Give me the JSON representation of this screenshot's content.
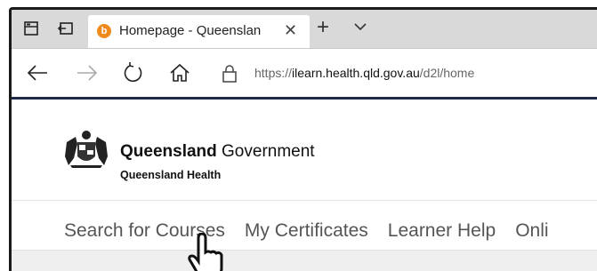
{
  "browser": {
    "tab": {
      "title": "Homepage - Queenslan",
      "favicon_letter": "b",
      "favicon_color": "#f08a1c"
    },
    "icons": [
      "tab-preview-icon",
      "set-aside-tabs-icon",
      "close-icon",
      "new-tab-icon",
      "tab-dropdown-icon",
      "back-icon",
      "forward-icon",
      "refresh-icon",
      "home-icon",
      "lock-icon"
    ],
    "address": {
      "scheme": "https://",
      "host": "ilearn.health.qld.gov.au",
      "path": "/d2l/home"
    }
  },
  "site": {
    "brand_bold": "Queensland",
    "brand_rest": " Government",
    "subbrand": "Queensland Health",
    "nav": [
      "Search for Courses",
      "My Certificates",
      "Learner Help",
      "Onli"
    ]
  },
  "accent_color": "#1f2a44"
}
